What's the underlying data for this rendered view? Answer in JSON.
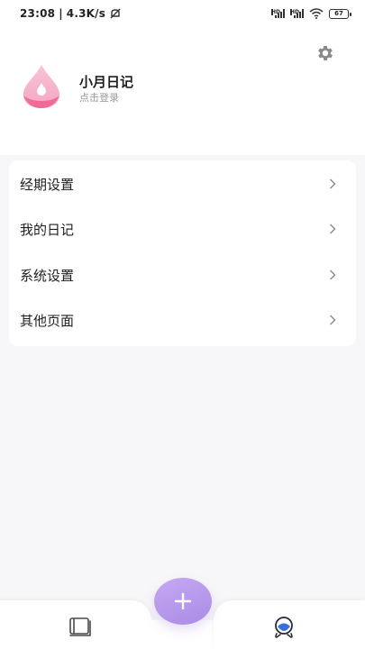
{
  "status_bar": {
    "time": "23:08",
    "separator": "|",
    "speed": "4.3K/s",
    "battery": "67"
  },
  "profile": {
    "name": "小月日记",
    "subtitle": "点击登录"
  },
  "menu": {
    "items": [
      {
        "label": "经期设置"
      },
      {
        "label": "我的日记"
      },
      {
        "label": "系统设置"
      },
      {
        "label": "其他页面"
      }
    ]
  },
  "icons": {
    "settings": "gear-icon",
    "avatar": "drop-logo-icon",
    "chevron": "chevron-right-icon",
    "add": "plus-icon",
    "nav_left": "book-icon",
    "nav_right": "profile-icon"
  },
  "colors": {
    "accent": "#b095ea",
    "logo_pink": "#f06a9a",
    "background": "#f7f7f9"
  }
}
